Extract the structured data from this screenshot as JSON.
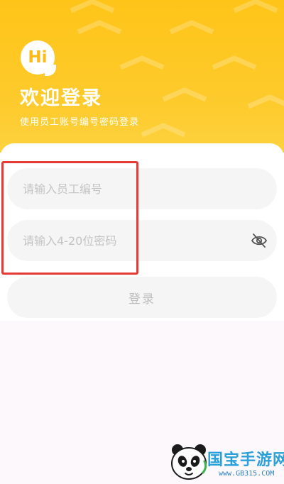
{
  "header": {
    "badge_text": "Hi",
    "title": "欢迎登录",
    "subtitle": "使用员工账号编号密码登录"
  },
  "form": {
    "employee_placeholder": "请输入员工编号",
    "employee_value": "",
    "password_placeholder": "请输入4-20位密码",
    "password_value": "",
    "login_label": "登录"
  },
  "icons": {
    "badge": "chat-bubble-icon",
    "password_toggle": "eye-off-icon"
  },
  "watermark": {
    "title": "国宝手游网",
    "url": "www.GB315.COM"
  },
  "colors": {
    "header_yellow": "#fec418",
    "badge_text": "#fdb916",
    "highlight": "#e53935",
    "field_bg": "#f5f5f5",
    "placeholder": "#c4c4c4"
  }
}
